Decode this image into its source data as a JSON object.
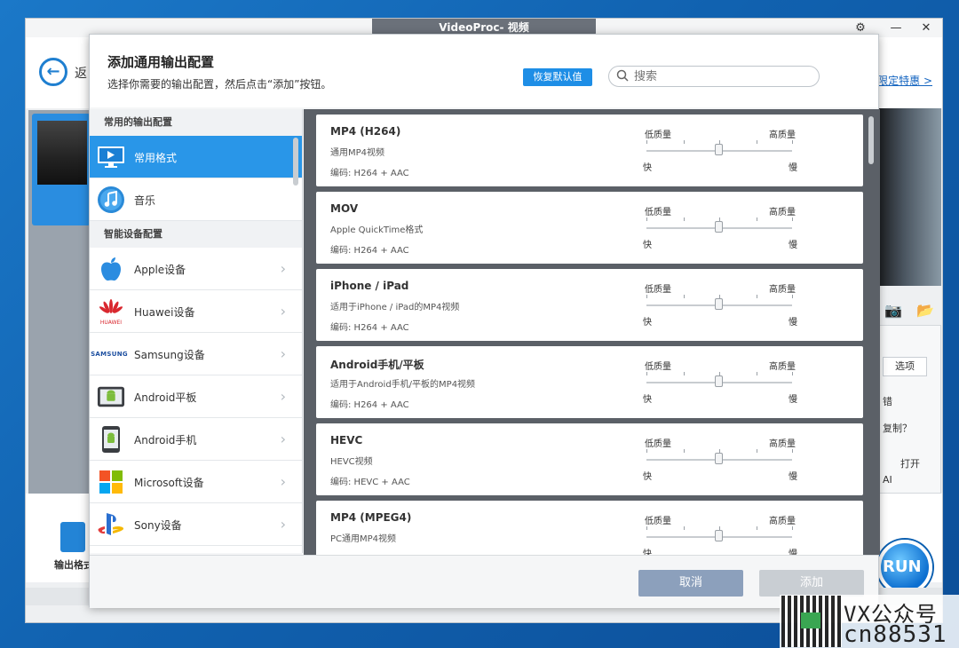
{
  "window": {
    "title": "VideoProc- 视频"
  },
  "background": {
    "back_text": "返",
    "promo_link": "限定特惠 >",
    "options_button": "选项",
    "text_err": "错",
    "text_copy": "复制？",
    "text_open": "打开",
    "text_ai": "AI",
    "output_format_label": "输出格式",
    "run_button": "RUN"
  },
  "dialog": {
    "title": "添加通用输出配置",
    "subtitle": "选择你需要的输出配置，然后点击“添加”按钮。",
    "restore_defaults": "恢复默认值",
    "search_placeholder": "搜索",
    "cancel": "取消",
    "add": "添加"
  },
  "sidebar": {
    "common_header": "常用的输出配置",
    "common_items": [
      {
        "label": "常用格式",
        "icon": "monitor-icon",
        "active": true
      },
      {
        "label": "音乐",
        "icon": "music-note-icon",
        "active": false
      }
    ],
    "device_header": "智能设备配置",
    "device_items": [
      {
        "label": "Apple设备",
        "icon": "apple-logo-icon"
      },
      {
        "label": "Huawei设备",
        "icon": "huawei-logo-icon"
      },
      {
        "label": "Samsung设备",
        "icon": "samsung-logo-icon",
        "logo_text": "SAMSUNG"
      },
      {
        "label": "Android平板",
        "icon": "android-tablet-icon"
      },
      {
        "label": "Android手机",
        "icon": "android-phone-icon"
      },
      {
        "label": "Microsoft设备",
        "icon": "microsoft-logo-icon"
      },
      {
        "label": "Sony设备",
        "icon": "playstation-logo-icon"
      }
    ],
    "huawei_logo_text": "HUAWEI",
    "accent": "#2996e8"
  },
  "profiles": [
    {
      "name": "MP4 (H264)",
      "desc": "通用MP4视频",
      "codec": "编码:  H264 + AAC",
      "low": "低质量",
      "high": "高质量",
      "fast": "快",
      "slow": "慢"
    },
    {
      "name": "MOV",
      "desc": "Apple QuickTime格式",
      "codec": "编码:  H264 + AAC",
      "low": "低质量",
      "high": "高质量",
      "fast": "快",
      "slow": "慢"
    },
    {
      "name": "iPhone / iPad",
      "desc": "适用于iPhone / iPad的MP4视频",
      "codec": "编码:  H264 + AAC",
      "low": "低质量",
      "high": "高质量",
      "fast": "快",
      "slow": "慢"
    },
    {
      "name": "Android手机/平板",
      "desc": "适用于Android手机/平板的MP4视频",
      "codec": "编码:  H264 + AAC",
      "low": "低质量",
      "high": "高质量",
      "fast": "快",
      "slow": "慢"
    },
    {
      "name": "HEVC",
      "desc": "HEVC视频",
      "codec": "编码:  HEVC + AAC",
      "low": "低质量",
      "high": "高质量",
      "fast": "快",
      "slow": "慢"
    },
    {
      "name": "MP4 (MPEG4)",
      "desc": "PC通用MP4视频",
      "codec": "",
      "low": "低质量",
      "high": "高质量",
      "fast": "快",
      "slow": "慢"
    }
  ],
  "watermark": {
    "line1": "VX公众号",
    "line2": "cn88531"
  }
}
